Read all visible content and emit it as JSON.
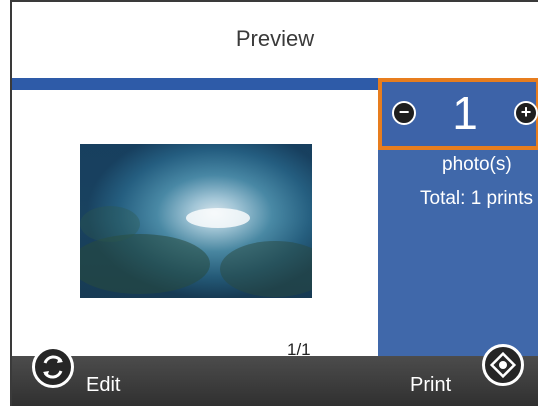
{
  "header": {
    "title": "Preview"
  },
  "preview": {
    "page_counter": "1/1"
  },
  "copies": {
    "value": "1",
    "minus_icon": "minus-circle-icon",
    "plus_icon": "plus-circle-icon"
  },
  "side_panel": {
    "photos_label": "photo(s)",
    "total_label": "Total: 1 prints"
  },
  "bottom_bar": {
    "edit_label": "Edit",
    "print_label": "Print",
    "edit_icon": "refresh-icon",
    "print_icon": "start-icon"
  },
  "colors": {
    "panel_blue": "#4068aa",
    "accent_orange": "#e77d1e",
    "bottom_bar": "#3a3a3a"
  }
}
